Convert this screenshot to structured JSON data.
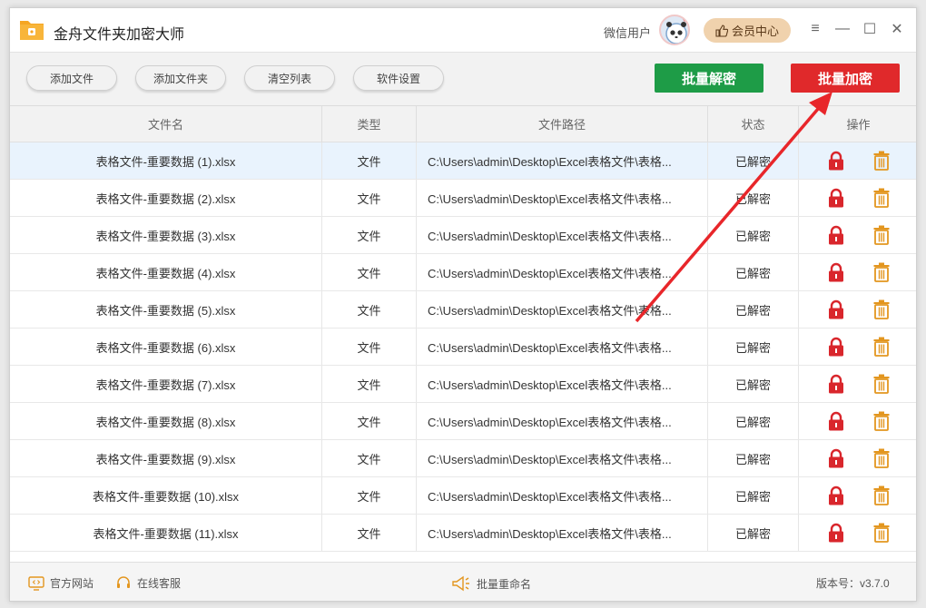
{
  "app": {
    "title": "金舟文件夹加密大师"
  },
  "user": {
    "name": "微信用户",
    "vip_label": "会员中心"
  },
  "toolbar": {
    "add_file": "添加文件",
    "add_folder": "添加文件夹",
    "clear_list": "清空列表",
    "settings": "软件设置",
    "batch_decrypt": "批量解密",
    "batch_encrypt": "批量加密"
  },
  "table": {
    "headers": [
      "文件名",
      "类型",
      "文件路径",
      "状态",
      "操作"
    ],
    "rows": [
      {
        "name": "表格文件-重要数据 (1).xlsx",
        "type": "文件",
        "path": "C:\\Users\\admin\\Desktop\\Excel表格文件\\表格...",
        "status": "已解密"
      },
      {
        "name": "表格文件-重要数据 (2).xlsx",
        "type": "文件",
        "path": "C:\\Users\\admin\\Desktop\\Excel表格文件\\表格...",
        "status": "已解密"
      },
      {
        "name": "表格文件-重要数据 (3).xlsx",
        "type": "文件",
        "path": "C:\\Users\\admin\\Desktop\\Excel表格文件\\表格...",
        "status": "已解密"
      },
      {
        "name": "表格文件-重要数据 (4).xlsx",
        "type": "文件",
        "path": "C:\\Users\\admin\\Desktop\\Excel表格文件\\表格...",
        "status": "已解密"
      },
      {
        "name": "表格文件-重要数据 (5).xlsx",
        "type": "文件",
        "path": "C:\\Users\\admin\\Desktop\\Excel表格文件\\表格...",
        "status": "已解密"
      },
      {
        "name": "表格文件-重要数据 (6).xlsx",
        "type": "文件",
        "path": "C:\\Users\\admin\\Desktop\\Excel表格文件\\表格...",
        "status": "已解密"
      },
      {
        "name": "表格文件-重要数据 (7).xlsx",
        "type": "文件",
        "path": "C:\\Users\\admin\\Desktop\\Excel表格文件\\表格...",
        "status": "已解密"
      },
      {
        "name": "表格文件-重要数据 (8).xlsx",
        "type": "文件",
        "path": "C:\\Users\\admin\\Desktop\\Excel表格文件\\表格...",
        "status": "已解密"
      },
      {
        "name": "表格文件-重要数据 (9).xlsx",
        "type": "文件",
        "path": "C:\\Users\\admin\\Desktop\\Excel表格文件\\表格...",
        "status": "已解密"
      },
      {
        "name": "表格文件-重要数据 (10).xlsx",
        "type": "文件",
        "path": "C:\\Users\\admin\\Desktop\\Excel表格文件\\表格...",
        "status": "已解密"
      },
      {
        "name": "表格文件-重要数据 (11).xlsx",
        "type": "文件",
        "path": "C:\\Users\\admin\\Desktop\\Excel表格文件\\表格...",
        "status": "已解密"
      }
    ],
    "action_icons": [
      "lock-icon",
      "trash-icon"
    ]
  },
  "footer": {
    "website": "官方网站",
    "support": "在线客服",
    "batch_rename": "批量重命名",
    "version": "版本号：v3.7.0"
  },
  "colors": {
    "decrypt_green": "#1e9c47",
    "encrypt_red": "#e0292b",
    "vip_tan": "#f0d2ad",
    "lock_red": "#d9262c",
    "trash_orange": "#e3961f",
    "selected_row": "#e9f3fd"
  }
}
